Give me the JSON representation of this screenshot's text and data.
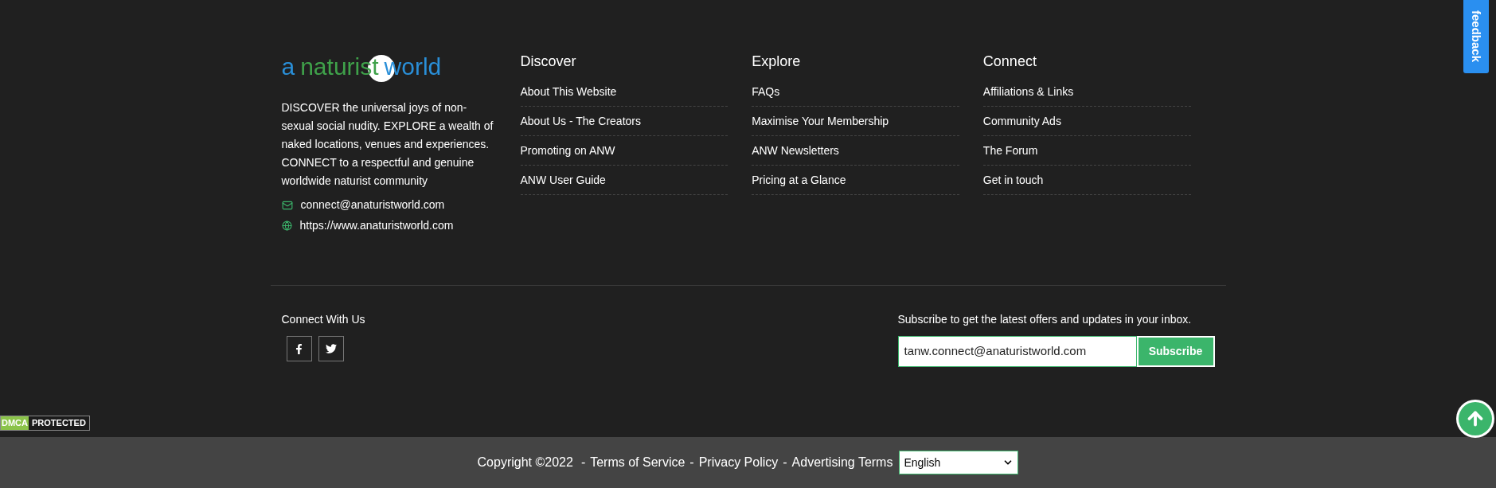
{
  "feedback_tab": {
    "label": "feedback"
  },
  "logo": {
    "words": [
      {
        "text": "a",
        "color": "#2a8fd8"
      },
      {
        "text": "naturist",
        "color": "#3fa14a"
      },
      {
        "text": "world",
        "color": "#2a8fd8"
      }
    ]
  },
  "about": {
    "text": "DISCOVER the universal joys of non-sexual social nudity. EXPLORE a wealth of naked locations, venues and experiences. CONNECT to a respectful and genuine worldwide naturist community",
    "contacts": [
      {
        "kind": "email",
        "text": "connect@anaturistworld.com"
      },
      {
        "kind": "web",
        "text": "https://www.anaturistworld.com"
      }
    ]
  },
  "columns": [
    {
      "heading": "Discover",
      "links": [
        "About This Website",
        "About Us - The Creators",
        "Promoting on ANW",
        "ANW User Guide"
      ]
    },
    {
      "heading": "Explore",
      "links": [
        "FAQs",
        "Maximise Your Membership",
        "ANW Newsletters",
        "Pricing at a Glance"
      ]
    },
    {
      "heading": "Connect",
      "links": [
        "Affiliations & Links",
        "Community Ads",
        "The Forum",
        "Get in touch"
      ]
    }
  ],
  "social": {
    "heading": "Connect With Us",
    "links": [
      {
        "kind": "facebook"
      },
      {
        "kind": "twitter"
      }
    ]
  },
  "subscribe": {
    "text": "Subscribe to get the latest offers and updates in your inbox.",
    "value": "tanw.connect@anaturistworld.com",
    "button": "Subscribe"
  },
  "dmca": {
    "left": "DMCA",
    "right": "PROTECTED"
  },
  "bottom_bar": {
    "copyright": "Copyright ©2022",
    "separator": "-",
    "links": [
      "Terms of Service",
      "Privacy Policy",
      "Advertising Terms"
    ],
    "language": "English"
  }
}
